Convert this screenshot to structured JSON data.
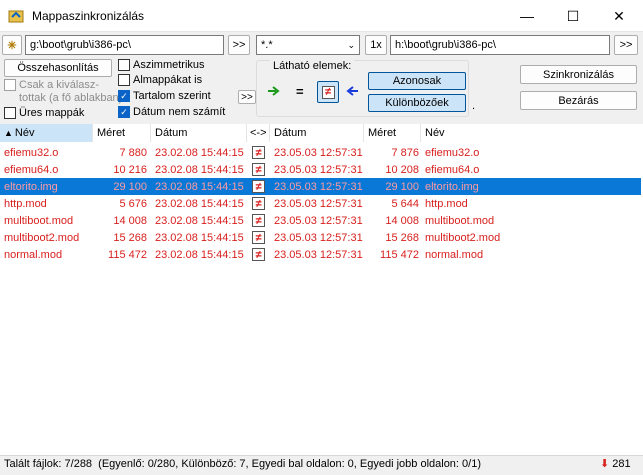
{
  "window": {
    "title": "Mappaszinkronizálás",
    "minimize": "—",
    "maximize": "☐",
    "close": "✕"
  },
  "left_path": "g:\\boot\\grub\\i386-pc\\",
  "right_path": "h:\\boot\\grub\\i386-pc\\",
  "arrows_label": ">>",
  "filter_value": "*.*",
  "one_x_label": "1x",
  "compare_button": "Összehasonlítás",
  "only_selected": "Csak a kiválasz-\ntottak (a fő ablakban)",
  "empty_folders": "Üres mappák",
  "asymmetric": "Aszimmetrikus",
  "subfolders": "Almappákat is",
  "by_content": "Tartalom szerint",
  "ignore_date": "Dátum nem számít",
  "visible_label": "Látható elemek:",
  "equal_sign": "=",
  "same_button": "Azonosak",
  "diff_button": "Különbözőek",
  "dot": ".",
  "sync_button": "Szinkronizálás",
  "close_button": "Bezárás",
  "headers": {
    "name_left": "Név",
    "size_left": "Méret",
    "date_left": "Dátum",
    "dir": "<->",
    "date_right": "Dátum",
    "size_right": "Méret",
    "name_right": "Név"
  },
  "rows": [
    {
      "name_l": "efiemu32.o",
      "size_l": "7 880",
      "date_l": "23.02.08 15:44:15",
      "date_r": "23.05.03 12:57:31",
      "size_r": "7 876",
      "name_r": "efiemu32.o"
    },
    {
      "name_l": "efiemu64.o",
      "size_l": "10 216",
      "date_l": "23.02.08 15:44:15",
      "date_r": "23.05.03 12:57:31",
      "size_r": "10 208",
      "name_r": "efiemu64.o"
    },
    {
      "name_l": "eltorito.img",
      "size_l": "29 100",
      "date_l": "23.02.08 15:44:15",
      "date_r": "23.05.03 12:57:31",
      "size_r": "29 100",
      "name_r": "eltorito.img"
    },
    {
      "name_l": "http.mod",
      "size_l": "5 676",
      "date_l": "23.02.08 15:44:15",
      "date_r": "23.05.03 12:57:31",
      "size_r": "5 644",
      "name_r": "http.mod"
    },
    {
      "name_l": "multiboot.mod",
      "size_l": "14 008",
      "date_l": "23.02.08 15:44:15",
      "date_r": "23.05.03 12:57:31",
      "size_r": "14 008",
      "name_r": "multiboot.mod"
    },
    {
      "name_l": "multiboot2.mod",
      "size_l": "15 268",
      "date_l": "23.02.08 15:44:15",
      "date_r": "23.05.03 12:57:31",
      "size_r": "15 268",
      "name_r": "multiboot2.mod"
    },
    {
      "name_l": "normal.mod",
      "size_l": "115 472",
      "date_l": "23.02.08 15:44:15",
      "date_r": "23.05.03 12:57:31",
      "size_r": "115 472",
      "name_r": "normal.mod"
    }
  ],
  "selected_row": 2,
  "status_text": "Talált fájlok: 7/288  (Egyenlő: 0/280, Különböző: 7, Egyedi bal oldalon: 0, Egyedi jobb oldalon: 0/1)",
  "status_count": "281",
  "colors": {
    "diff_text": "#d8201e",
    "selection": "#0a78d7",
    "accent": "#0a64c8"
  }
}
